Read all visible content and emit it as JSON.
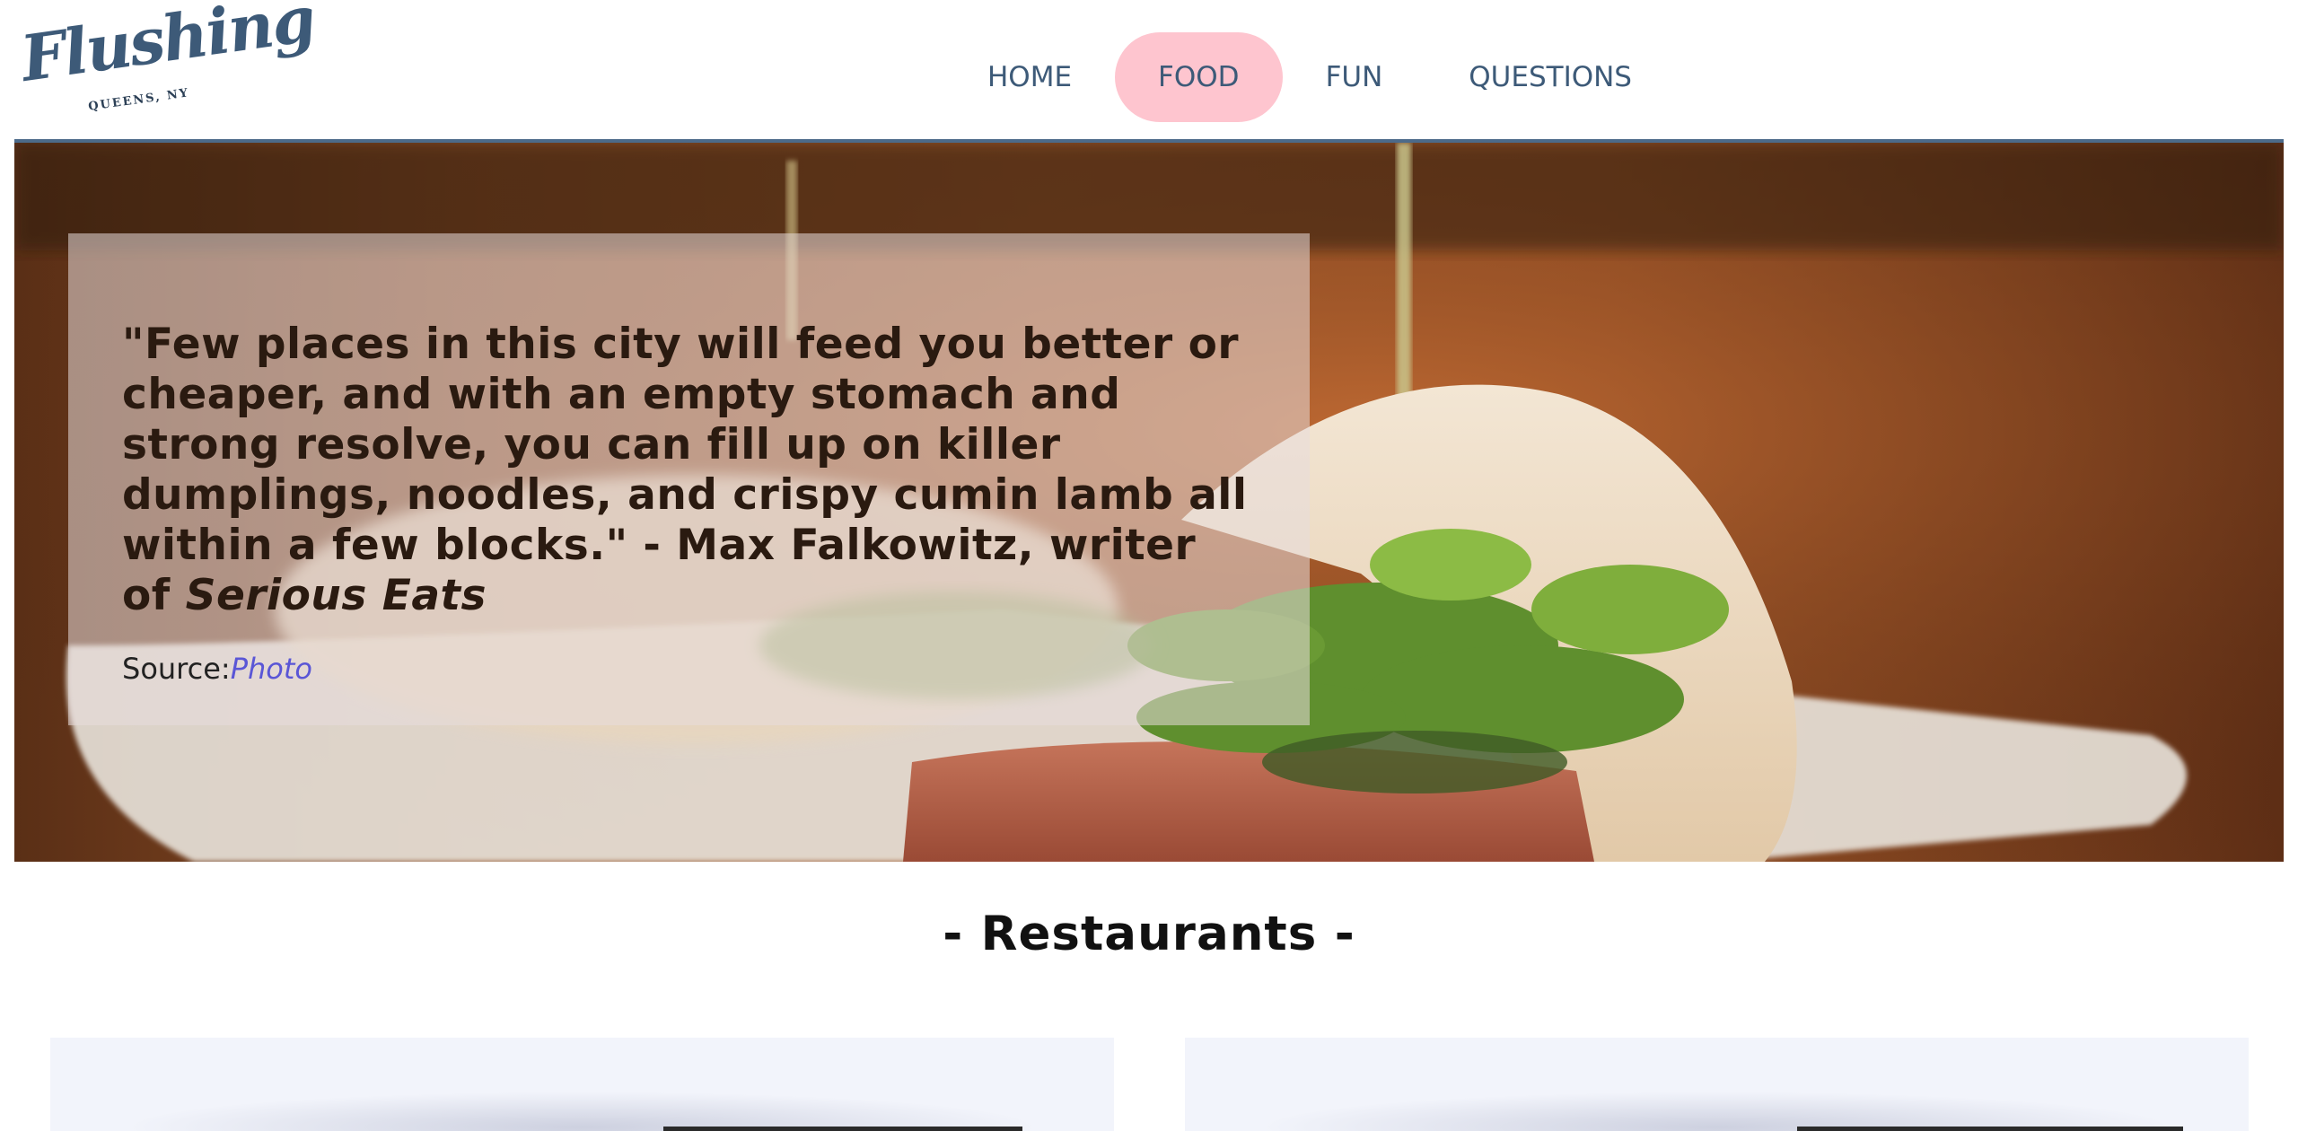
{
  "logo": {
    "script": "Flushing",
    "subtitle": "QUEENS, NY"
  },
  "nav": {
    "items": [
      {
        "label": "HOME",
        "active": false
      },
      {
        "label": "FOOD",
        "active": true
      },
      {
        "label": "FUN",
        "active": false
      },
      {
        "label": "QUESTIONS",
        "active": false
      }
    ],
    "active_color": "#fec5cf",
    "text_color": "#3d5a78"
  },
  "hero": {
    "quote": "\"Few places in this city will feed you better or cheaper, and with an empty stomach and strong resolve, you can fill up on killer dumplings, noodles, and crispy cumin lamb all within a few blocks.\" - Max Falkowitz, writer of ",
    "quote_publication": "Serious Eats",
    "source_label": "Source:",
    "source_link": "Photo"
  },
  "restaurants": {
    "title": "- Restaurants -"
  },
  "colors": {
    "accent": "#4c6a8a",
    "link": "#5a56d6"
  }
}
